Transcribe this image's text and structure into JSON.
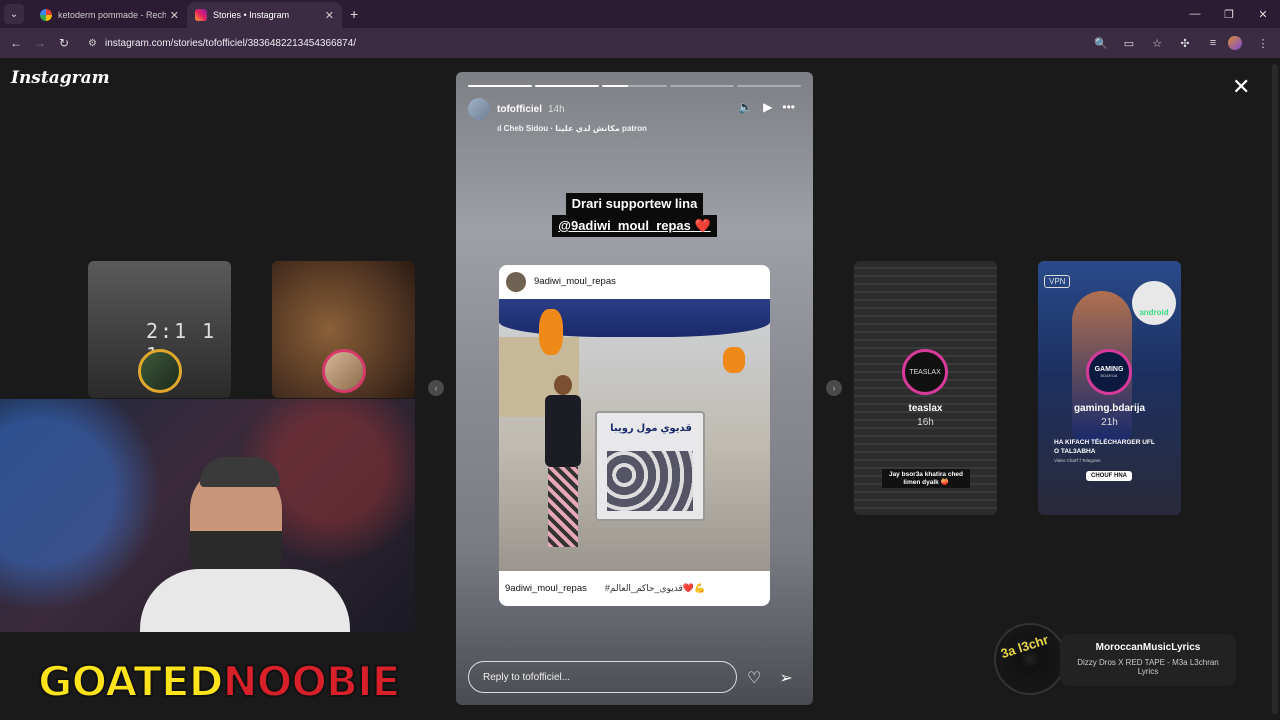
{
  "browser": {
    "tabs": [
      {
        "title": "ketoderm pommade - Recherche",
        "active": false
      },
      {
        "title": "Stories • Instagram",
        "active": true
      }
    ],
    "url": "instagram.com/stories/tofofficiel/3836482213454366874/"
  },
  "instagram": {
    "logo": "Instagram",
    "story": {
      "username": "tofofficiel",
      "time": "14h",
      "music": "Cheb Sidou · مكانش لدي علينا patron",
      "sticker_line1": "Drari supportew lina",
      "sticker_line2": "@9adiwi_moul_repas ❤️",
      "post_username": "9adiwi_moul_repas",
      "post_footer_user": "9adiwi_moul_repas",
      "post_caption": "#قديوي_حاكم_العالم❤️💪",
      "cart_sign": "قديوي مول رويبا",
      "reply_placeholder": "Reply to tofofficiel..."
    },
    "thumbnails": [
      {
        "side": "left",
        "overlay": "2:1 1 1"
      },
      {
        "side": "left",
        "overlay": ""
      },
      {
        "side": "right",
        "username": "teaslax",
        "time": "16h",
        "caption": "Jay bsor3a khatira ched limen dyalk 🍑"
      },
      {
        "side": "right",
        "username": "gaming.bdarija",
        "time": "21h",
        "badge": "VPN",
        "brand": "android",
        "logo_text": "GAMING",
        "logo_sub": "BDARIJA",
        "line1": "HA KIFACH TÉLÉCHARGER UFL",
        "line2": "O TAL3ABHA",
        "line3": "Video Chat'f f Telegram",
        "cta": "CHOUF HNA"
      }
    ]
  },
  "overlay": {
    "streamer": {
      "part1": "GOATED",
      "part2": "NOOBIE"
    },
    "now_playing": {
      "channel": "MoroccanMusicLyrics",
      "title": "Dizzy Dros X RED TAPE - M3a L3chran Lyrics",
      "disc_text": "3a l3chr"
    }
  }
}
